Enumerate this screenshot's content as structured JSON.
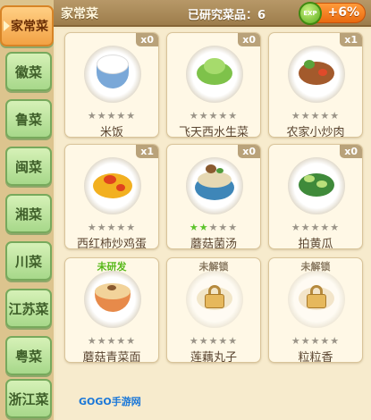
{
  "sidebar": {
    "tabs": [
      {
        "label": "家常菜",
        "active": true
      },
      {
        "label": "徽菜",
        "active": false
      },
      {
        "label": "鲁菜",
        "active": false
      },
      {
        "label": "闽菜",
        "active": false
      },
      {
        "label": "湘菜",
        "active": false
      },
      {
        "label": "川菜",
        "active": false
      },
      {
        "label": "江苏菜",
        "active": false
      },
      {
        "label": "粤菜",
        "active": false
      },
      {
        "label": "浙江菜",
        "active": false
      }
    ]
  },
  "header": {
    "title": "家常菜",
    "researched": "已研究菜品：6",
    "exp_icon_label": "EXP",
    "exp_bonus": "+6%"
  },
  "dishes": [
    {
      "name": "米饭",
      "count": "x0",
      "status": "",
      "stars_filled": 0,
      "stars_total": 5,
      "locked": false,
      "icon": "rice-bowl-icon"
    },
    {
      "name": "飞天西水生菜",
      "count": "x0",
      "status": "",
      "stars_filled": 0,
      "stars_total": 5,
      "locked": false,
      "icon": "lettuce-plate-icon"
    },
    {
      "name": "农家小炒肉",
      "count": "x1",
      "status": "",
      "stars_filled": 0,
      "stars_total": 5,
      "locked": false,
      "icon": "stir-fry-pork-icon"
    },
    {
      "name": "西红柿炒鸡蛋",
      "count": "x1",
      "status": "",
      "stars_filled": 0,
      "stars_total": 5,
      "locked": false,
      "icon": "tomato-egg-icon"
    },
    {
      "name": "蘑菇菌汤",
      "count": "x0",
      "status": "",
      "stars_filled": 2,
      "stars_total": 5,
      "locked": false,
      "icon": "mushroom-soup-icon"
    },
    {
      "name": "拍黄瓜",
      "count": "x0",
      "status": "",
      "stars_filled": 0,
      "stars_total": 5,
      "locked": false,
      "icon": "cucumber-salad-icon"
    },
    {
      "name": "蘑菇青菜面",
      "count": "",
      "status": "未研发",
      "stars_filled": 0,
      "stars_total": 5,
      "locked": false,
      "icon": "noodle-bowl-icon"
    },
    {
      "name": "莲藕丸子",
      "count": "",
      "status": "未解锁",
      "stars_filled": 0,
      "stars_total": 5,
      "locked": true,
      "icon": "lock-icon"
    },
    {
      "name": "粒粒香",
      "count": "",
      "status": "未解锁",
      "stars_filled": 0,
      "stars_total": 5,
      "locked": true,
      "icon": "lock-icon"
    }
  ],
  "watermark": {
    "text": "GOGO手游网"
  },
  "colors": {
    "active_tab": "#f2a244",
    "inactive_tab": "#a7d88a",
    "status_unresearched": "#58b81a",
    "status_locked": "#8a7a62",
    "exp_pill": "#e96a10"
  }
}
